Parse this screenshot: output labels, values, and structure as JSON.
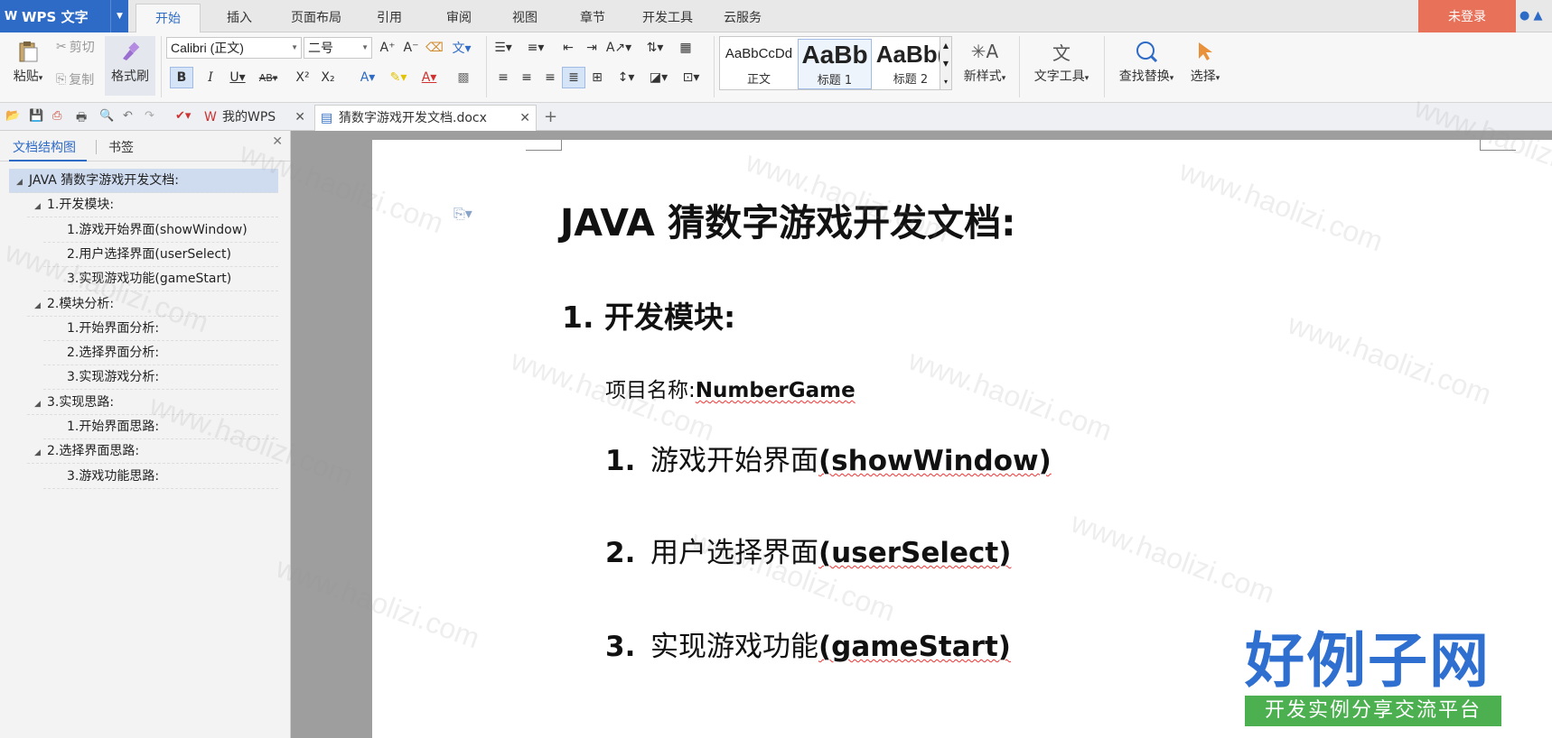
{
  "app": {
    "name": "WPS 文字"
  },
  "menu_tabs": [
    "开始",
    "插入",
    "页面布局",
    "引用",
    "审阅",
    "视图",
    "章节",
    "开发工具",
    "云服务"
  ],
  "active_menu_tab": "开始",
  "login_label": "未登录",
  "ribbon": {
    "clipboard": {
      "paste": "粘贴",
      "cut": "剪切",
      "copy": "复制",
      "format_painter": "格式刷"
    },
    "font": {
      "name": "Calibri (正文)",
      "size": "二号"
    },
    "styles": [
      {
        "preview": "AaBbCcDd",
        "label": "正文"
      },
      {
        "preview": "AaBb",
        "label": "标题 1"
      },
      {
        "preview": "AaBb(",
        "label": "标题 2"
      }
    ],
    "new_style": "新样式",
    "text_tools": "文字工具",
    "find_replace": "查找替换",
    "select": "选择"
  },
  "doc_tabs": [
    {
      "label": "我的WPS",
      "active": false
    },
    {
      "label": "猜数字游戏开发文档.docx",
      "active": true
    }
  ],
  "sidebar": {
    "tabs": [
      "文档结构图",
      "书签"
    ],
    "tree": [
      {
        "label": "JAVA 猜数字游戏开发文档:",
        "level": 0,
        "expandable": true,
        "selected": true
      },
      {
        "label": "1.开发模块:",
        "level": 1,
        "expandable": true
      },
      {
        "label": "1.游戏开始界面(showWindow)",
        "level": 2
      },
      {
        "label": "2.用户选择界面(userSelect)",
        "level": 2
      },
      {
        "label": "3.实现游戏功能(gameStart)",
        "level": 2
      },
      {
        "label": "2.模块分析:",
        "level": 1,
        "expandable": true
      },
      {
        "label": "1.开始界面分析:",
        "level": 2
      },
      {
        "label": "2.选择界面分析:",
        "level": 2
      },
      {
        "label": "3.实现游戏分析:",
        "level": 2
      },
      {
        "label": "3.实现思路:",
        "level": 1,
        "expandable": true
      },
      {
        "label": "1.开始界面思路:",
        "level": 2
      },
      {
        "label": "2.选择界面思路:",
        "level": 1,
        "expandable": true
      },
      {
        "label": "3.游戏功能思路:",
        "level": 2
      }
    ]
  },
  "document": {
    "title": "JAVA 猜数字游戏开发文档:",
    "heading": "1. 开发模块:",
    "project_label": "项目名称:",
    "project_name": "NumberGame",
    "items": [
      {
        "num": "1.",
        "zh": "游戏开始界面",
        "en": "(showWindow)"
      },
      {
        "num": "2.",
        "zh": "用户选择界面",
        "en": "(userSelect)"
      },
      {
        "num": "3.",
        "zh": "实现游戏功能",
        "en": "(gameStart)"
      }
    ]
  },
  "watermark": {
    "text": "www.haolizi.com",
    "brand": "好例子网",
    "brand_sub": "开发实例分享交流平台"
  }
}
